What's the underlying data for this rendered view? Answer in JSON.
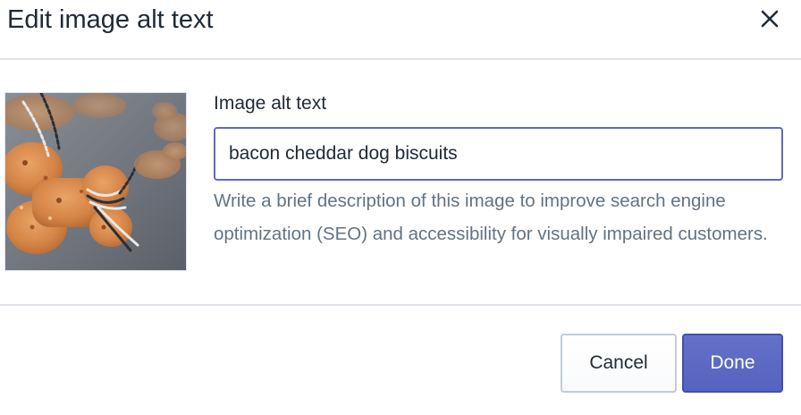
{
  "modal": {
    "title": "Edit image alt text",
    "close_icon": "close-icon"
  },
  "image": {
    "icon": "dog-biscuits-thumbnail"
  },
  "field": {
    "label": "Image alt text",
    "value": "bacon cheddar dog biscuits",
    "help_text": "Write a brief description of this image to improve search engine optimization (SEO) and accessibility for visually impaired customers."
  },
  "footer": {
    "cancel_label": "Cancel",
    "done_label": "Done"
  },
  "colors": {
    "primary": "#5c6ac4",
    "text": "#212b36",
    "subdued_text": "#637381",
    "divider": "#dfe3e8"
  }
}
